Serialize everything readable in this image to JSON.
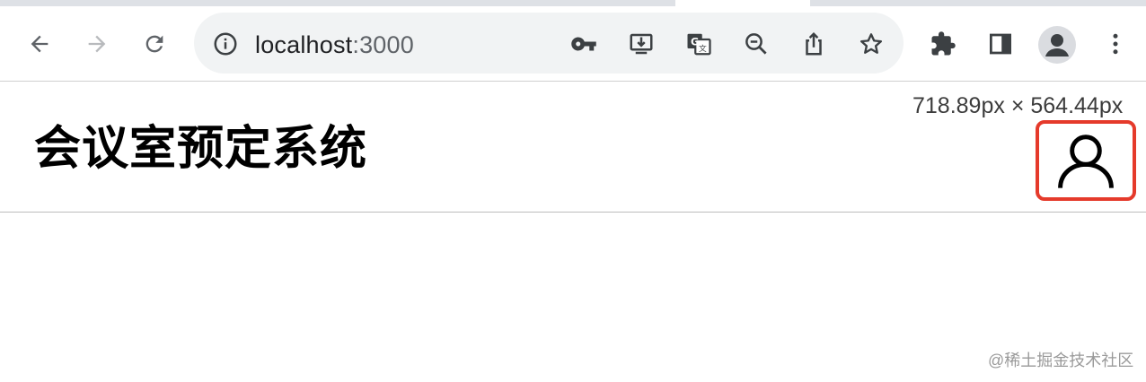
{
  "browser": {
    "url_host": "localhost",
    "url_port": ":3000",
    "icons": {
      "back": "back-arrow-icon",
      "forward": "forward-arrow-icon",
      "reload": "reload-icon",
      "site_info": "info-icon",
      "password": "key-icon",
      "install": "install-app-icon",
      "translate": "translate-icon",
      "zoom": "zoom-out-icon",
      "share": "share-icon",
      "bookmark": "star-icon",
      "extensions": "puzzle-icon",
      "side_panel": "side-panel-icon",
      "profile": "profile-avatar-icon",
      "menu": "kebab-menu-icon"
    }
  },
  "page": {
    "dimension_readout": "718.89px × 564.44px",
    "title": "会议室预定系统",
    "user_icon": "user-icon",
    "highlight_color": "#e53a2b"
  },
  "watermark": "@稀土掘金技术社区"
}
